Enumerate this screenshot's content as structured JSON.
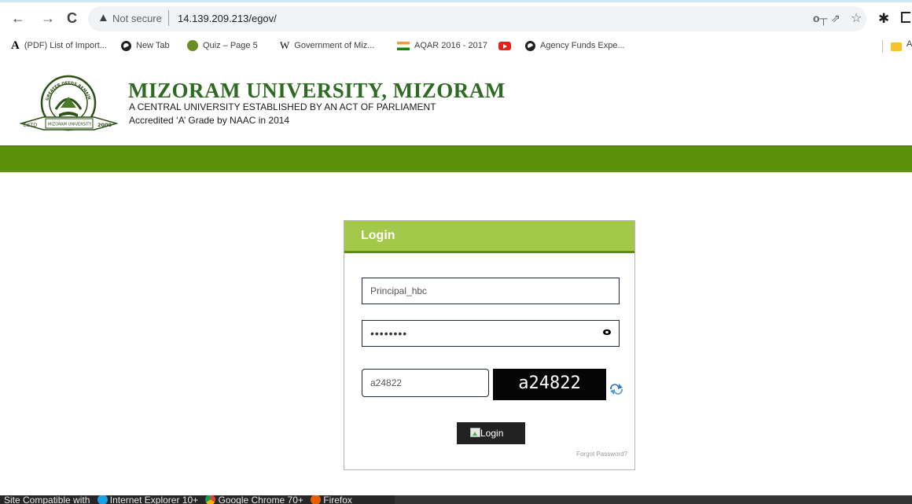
{
  "browser": {
    "security_label": "Not secure",
    "url": "14.139.209.213/egov/",
    "bookmarks": [
      {
        "label": "(PDF) List of Import...",
        "icon": "academia-icon"
      },
      {
        "label": "New Tab",
        "icon": "globe-icon"
      },
      {
        "label": "Quiz – Page 5",
        "icon": "quiz-icon"
      },
      {
        "label": "Government of Miz...",
        "icon": "wikipedia-icon"
      },
      {
        "label": "AQAR 2016 - 2017",
        "icon": "india-flag-icon"
      },
      {
        "label": "",
        "icon": "youtube-icon"
      },
      {
        "label": "Agency Funds Expe...",
        "icon": "globe-icon"
      }
    ],
    "bookmark_overflow": "A"
  },
  "site": {
    "title": "MIZORAM UNIVERSITY, MIZORAM",
    "subtitle": "A CENTRAL UNIVERSITY ESTABLISHED BY AN ACT OF PARLIAMENT",
    "accreditation": "Accredited ‘A’ Grade by NAAC in 2014",
    "brand_color": "#5b910d",
    "logo_text": {
      "top": "GREATER DEEDS REMAIN",
      "left": "ESTD",
      "banner": "MIZORAM UNIVERSITY",
      "right": "2000"
    }
  },
  "login": {
    "header": "Login",
    "username_value": "Principal_hbc",
    "password_mask": "••••••••",
    "captcha_input_value": "a24822",
    "captcha_text": "a24822",
    "button_label": "Login",
    "forgot_label": "Forgot Password?"
  },
  "footer": {
    "prefix": "Site Compatible with",
    "browsers": [
      "Internet Explorer 10+",
      "Google Chrome 70+",
      "Firefox"
    ]
  }
}
